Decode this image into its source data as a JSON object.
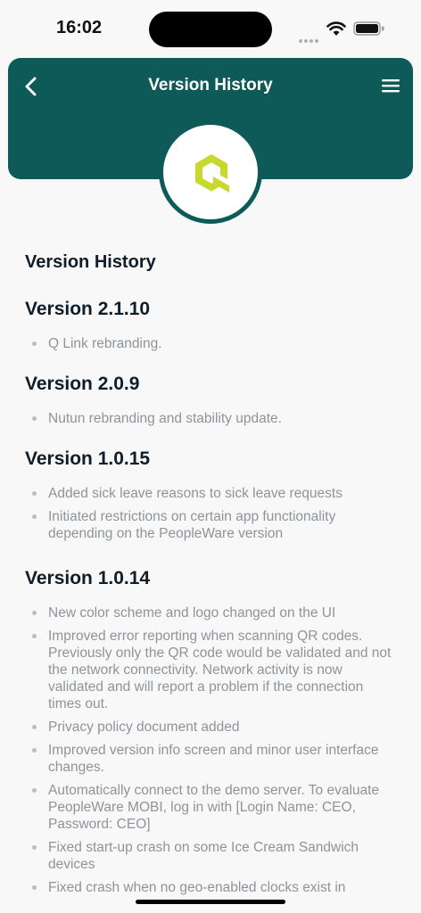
{
  "status_bar": {
    "time": "16:02"
  },
  "header": {
    "title": "Version History"
  },
  "colors": {
    "brand": "#0d5a58",
    "logo": "#c7d92b",
    "heading": "#0f1e2a",
    "note_text": "#8e9499"
  },
  "page": {
    "heading": "Version History",
    "versions": [
      {
        "title": "Version 2.1.10",
        "notes": [
          "Q Link rebranding."
        ]
      },
      {
        "title": "Version 2.0.9",
        "notes": [
          "Nutun rebranding and stability update."
        ]
      },
      {
        "title": "Version 1.0.15",
        "notes": [
          "Added sick leave reasons to sick leave requests",
          "Initiated restrictions on certain app functionality depending on the PeopleWare version"
        ]
      },
      {
        "title": "Version 1.0.14",
        "notes": [
          "New color scheme and logo changed on the UI",
          "Improved error reporting when scanning QR codes. Previously only the QR code would be validated and not the network connectivity. Network activity is now validated and will report a problem if the connection times out.",
          "Privacy policy document added",
          " Improved version info screen and minor user interface changes.",
          "Automatically connect to the demo server. To evaluate PeopleWare MOBI, log in with [Login Name: CEO, Password: CEO]",
          "Fixed start-up crash on some Ice Cream Sandwich devices",
          "Fixed crash when no geo-enabled clocks exist in"
        ]
      }
    ]
  }
}
